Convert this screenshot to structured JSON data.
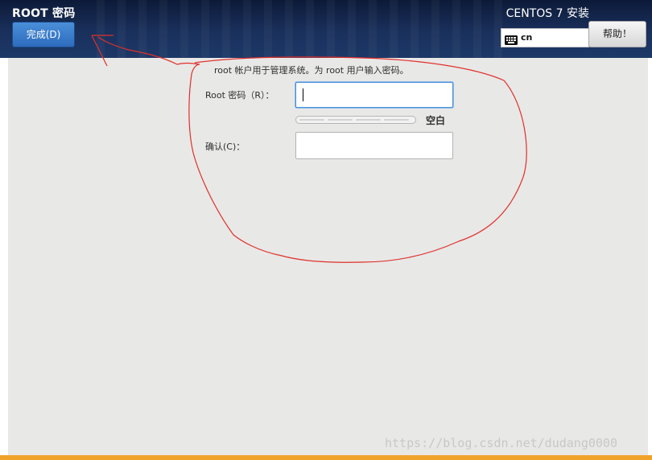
{
  "header": {
    "page_title": "ROOT 密码",
    "done_button_label": "完成(D)",
    "product_title": "CENTOS 7 安装",
    "keyboard_layout": "cn",
    "help_button_label": "帮助！"
  },
  "form": {
    "description": "root 帐户用于管理系统。为 root 用户输入密码。",
    "root_password_label": "Root 密码（R）：",
    "root_password_value": "",
    "strength_label": "空白",
    "strength_level": 0,
    "confirm_label": "确认(C)：",
    "confirm_value": ""
  },
  "watermark": "https://blog.csdn.net/dudang0000",
  "colors": {
    "header_bg": "#1d3867",
    "accent_button": "#3a7fd0",
    "content_bg": "#e8e8e7",
    "bottom_bar": "#f0a32a",
    "annotation_stroke": "#e0302a"
  },
  "icons": {
    "keyboard": "keyboard-icon"
  }
}
